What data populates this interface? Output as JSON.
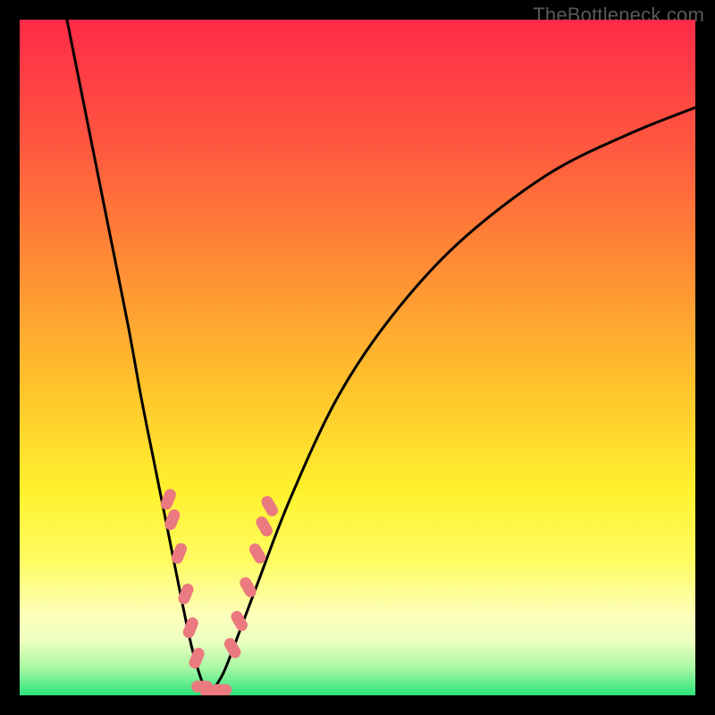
{
  "watermark": "TheBottleneck.com",
  "chart_data": {
    "type": "line",
    "title": "",
    "xlabel": "",
    "ylabel": "",
    "xlim": [
      0,
      100
    ],
    "ylim": [
      0,
      100
    ],
    "series": [
      {
        "name": "left-curve",
        "x": [
          7,
          10,
          13,
          16,
          18,
          20,
          22,
          24,
          25.5,
          27,
          28
        ],
        "values": [
          100,
          85,
          70,
          55,
          44,
          34,
          24,
          14,
          7,
          2,
          0
        ]
      },
      {
        "name": "right-curve",
        "x": [
          28,
          30,
          32,
          35,
          40,
          47,
          55,
          65,
          78,
          90,
          100
        ],
        "values": [
          0,
          3,
          8,
          16,
          29,
          44,
          56,
          67,
          77,
          83,
          87
        ]
      }
    ],
    "markers": [
      {
        "name": "left-marker-cluster",
        "shape": "oblong",
        "color": "#ea7a7f",
        "points": [
          {
            "x": 22.0,
            "y": 29.0,
            "orient": "diag"
          },
          {
            "x": 22.6,
            "y": 26.0,
            "orient": "diag"
          },
          {
            "x": 23.6,
            "y": 21.0,
            "orient": "diag"
          },
          {
            "x": 24.6,
            "y": 15.0,
            "orient": "diag"
          },
          {
            "x": 25.3,
            "y": 10.0,
            "orient": "diag"
          },
          {
            "x": 26.2,
            "y": 5.5,
            "orient": "diag"
          }
        ]
      },
      {
        "name": "right-marker-cluster",
        "shape": "oblong",
        "color": "#ea7a7f",
        "points": [
          {
            "x": 31.5,
            "y": 7.0,
            "orient": "diag-r"
          },
          {
            "x": 32.5,
            "y": 11.0,
            "orient": "diag-r"
          },
          {
            "x": 33.8,
            "y": 16.0,
            "orient": "diag-r"
          },
          {
            "x": 35.2,
            "y": 21.0,
            "orient": "diag-r"
          },
          {
            "x": 36.2,
            "y": 25.0,
            "orient": "diag-r"
          },
          {
            "x": 37.0,
            "y": 28.0,
            "orient": "diag-r"
          }
        ]
      },
      {
        "name": "bottom-marker-cluster",
        "shape": "oblong",
        "color": "#ea7a7f",
        "points": [
          {
            "x": 27.0,
            "y": 1.3,
            "orient": "horiz"
          },
          {
            "x": 28.3,
            "y": 0.6,
            "orient": "horiz"
          },
          {
            "x": 29.8,
            "y": 0.8,
            "orient": "horiz"
          }
        ]
      }
    ],
    "gradient_stops": [
      {
        "pos": 0.0,
        "color": "#ff2a48"
      },
      {
        "pos": 0.18,
        "color": "#ff5640"
      },
      {
        "pos": 0.36,
        "color": "#ff8b35"
      },
      {
        "pos": 0.54,
        "color": "#ffc22c"
      },
      {
        "pos": 0.7,
        "color": "#fff22e"
      },
      {
        "pos": 0.8,
        "color": "#fffc61"
      },
      {
        "pos": 0.88,
        "color": "#fdffb8"
      },
      {
        "pos": 0.92,
        "color": "#ecffc0"
      },
      {
        "pos": 0.96,
        "color": "#a6f7a3"
      },
      {
        "pos": 1.0,
        "color": "#2be37a"
      }
    ]
  }
}
